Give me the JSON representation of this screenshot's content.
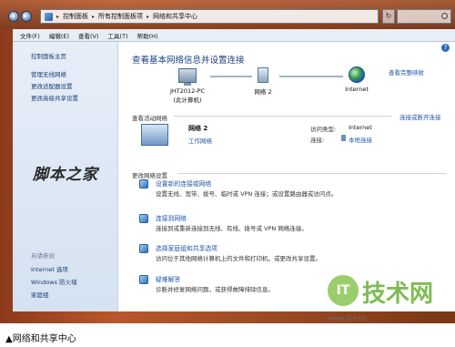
{
  "address_bar": {
    "crumbs": [
      "控制面板",
      "所有控制面板项",
      "网络和共享中心"
    ]
  },
  "menubar": {
    "items": [
      "文件(F)",
      "编辑(E)",
      "查看(V)",
      "工具(T)",
      "帮助(H)"
    ]
  },
  "sidebar": {
    "home": "控制面板主页",
    "links": [
      "管理无线网络",
      "更改适配器设置",
      "更改高级共享设置"
    ],
    "see_also_label": "另请参阅",
    "see_also": [
      "Internet 选项",
      "Windows 防火墙",
      "家庭组"
    ]
  },
  "main": {
    "title": "查看基本网络信息并设置连接",
    "view_full_map": "查看完整映射",
    "map": {
      "computer_name": "JHT2012-PC",
      "computer_sub": "(此计算机)",
      "network": "网络 2",
      "internet": "Internet"
    },
    "active_section": "查看活动网络",
    "connect_disconnect": "连接或断开连接",
    "active_network": {
      "name": "网络 2",
      "type": "工作网络",
      "access_type_label": "访问类型:",
      "access_type_value": "Internet",
      "connections_label": "连接:",
      "connections_value": "本地连接"
    },
    "change_section": "更改网络设置",
    "tasks": [
      {
        "title": "设置新的连接或网络",
        "desc": "设置无线、宽带、拨号、临时或 VPN 连接；或设置路由器或访问点。"
      },
      {
        "title": "连接到网络",
        "desc": "连接到或重新连接到无线、有线、拨号或 VPN 网络连接。"
      },
      {
        "title": "选择家庭组和共享选项",
        "desc": "访问位于其他网络计算机上的文件和打印机，或更改共享设置。"
      },
      {
        "title": "疑难解答",
        "desc": "诊断并修复网络问题，或获得故障排除信息。"
      }
    ]
  },
  "watermarks": {
    "left": "脚本之家",
    "logo_letter": "IT",
    "logo_brand": "技术网",
    "url": "www.itjs.cn"
  },
  "caption": "▲网络和共享中心"
}
